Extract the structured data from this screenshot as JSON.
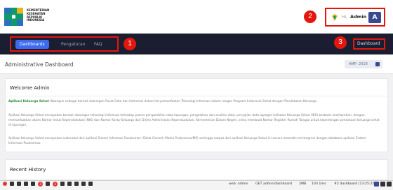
{
  "header": {
    "logo_lines": [
      "KEMENTERIAN",
      "KESEHATAN",
      "REPUBLIK",
      "INDONESIA"
    ],
    "callouts": [
      "1",
      "2",
      "3"
    ],
    "user": {
      "greeting": "Hi,",
      "name": "Admin",
      "avatar_letter": "A"
    }
  },
  "nav": {
    "tabs": [
      {
        "label": "Dashboards",
        "active": true
      },
      {
        "label": "Pengaturan",
        "active": false
      },
      {
        "label": "FAQ",
        "active": false
      }
    ],
    "right_link": "Dashboard"
  },
  "page": {
    "title": "Administrative Dashboard",
    "year_badge": "AMP: 2018"
  },
  "welcome": {
    "title": "Welcome Admin",
    "p1_lead": "Aplikasi Keluarga Sehat",
    "p1_rest": " dibangun sebagai bentuk dukungan Pusat Data dan Informasi dalam hal pemanfaatan Teknologi Informasi dalam rangka Program Indonesia Sehat dengan Pendekatan Keluarga.",
    "p2": "Aplikasi Keluarga Sehat merupakan bentuk dukungan teknologi informasi terhadap proses pengambilan data lapangan, pengolahan dan analisis data, penyajian data agregat indikator Keluarga Sehat (IKS) berbasis kewilayahan, dengan memanfaatkan akses Nomor Induk Kependudukan (NIK) dan Nomor Kartu Keluarga dari Dirjen Administrasi Kependudukan, Kementerian Dalam Negeri, serta membuat Nomor Register Rumah Tangga untuk kepentingan pendataan keluarga sehat di lapangan.",
    "p3": "Aplikasi Keluarga Sehat merupakan submodul dari aplikasi Sistem Informasi Puskesmas (Sikda Generik Modul Puskesmas/MP) sehingga output dari aplikasi Keluarga Sehat ini secara otomatis terintegrasi dengan database aplikasi Sistem Informasi Puskesmas."
  },
  "recent": {
    "title": "Recent History"
  },
  "debugbar": {
    "badge_a": "3",
    "badge_b": "1",
    "user": "web: admin",
    "route": "GET admin/dashboard",
    "memory": "2MB",
    "time": "103.1ms",
    "request": "#2 dashboard (13:25:25)"
  },
  "colors": {
    "accent": "#3d6bf0",
    "nav_bg": "#1b1e30",
    "callout": "#e4170e",
    "avatar": "#3b4a8f"
  }
}
